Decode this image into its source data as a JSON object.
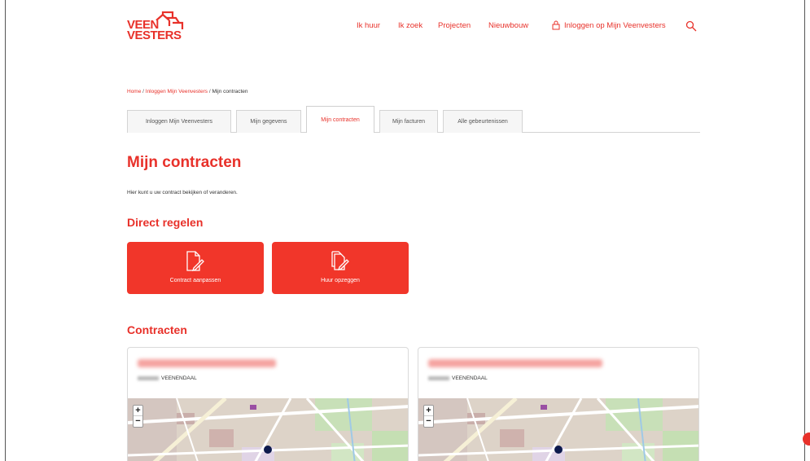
{
  "header": {
    "logo_line1": "VEEN",
    "logo_line2": "VESTERS",
    "nav": [
      {
        "label": "Ik huur"
      },
      {
        "label": "Ik zoek"
      },
      {
        "label": "Projecten"
      },
      {
        "label": "Nieuwbouw"
      }
    ],
    "login_label": "Inloggen op Mijn Veenvesters"
  },
  "breadcrumb": {
    "home": "Home",
    "sep": " / ",
    "login": "Inloggen Mijn Veenvesters",
    "current": "Mijn contracten"
  },
  "tabs": [
    {
      "label": "Inloggen Mijn Veenvesters"
    },
    {
      "label": "Mijn gegevens"
    },
    {
      "label": "Mijn contracten"
    },
    {
      "label": "Mijn facturen"
    },
    {
      "label": "Alle gebeurtenissen"
    }
  ],
  "page": {
    "title": "Mijn contracten",
    "intro": "Hier kunt u uw contract bekijken of veranderen."
  },
  "direct": {
    "heading": "Direct regelen",
    "actions": [
      {
        "label": "Contract aanpassen",
        "icon": "contract-edit-icon"
      },
      {
        "label": "Huur opzeggen",
        "icon": "cancel-rent-icon"
      }
    ]
  },
  "contracts": {
    "heading": "Contracten",
    "items": [
      {
        "city": "VEENENDAAL"
      },
      {
        "city": "VEENENDAAL"
      }
    ],
    "zoom_in": "+",
    "zoom_out": "−"
  },
  "colors": {
    "brand_red": "#e8312a",
    "button_red": "#f1362a",
    "pin": "#0d1a4d"
  }
}
